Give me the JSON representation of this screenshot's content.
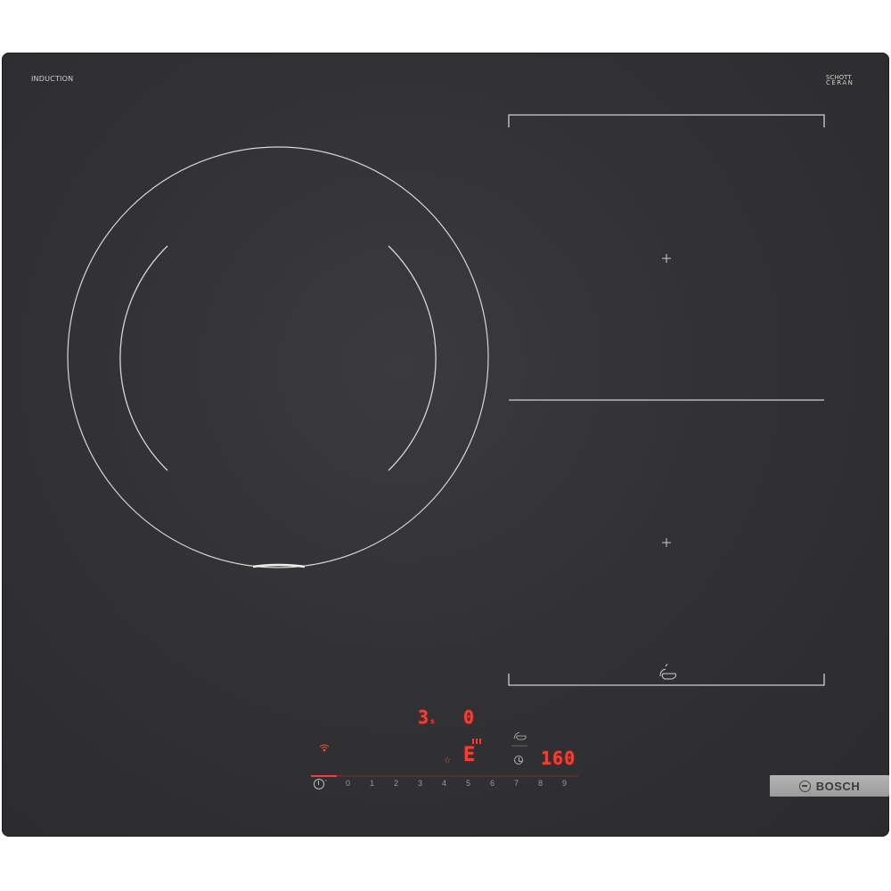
{
  "branding": {
    "induction_label": "INDUCTION",
    "schott_line1": "SCHOTT",
    "schott_line2": "CERAN",
    "brand_name": "BOSCH"
  },
  "displays": {
    "timer_seconds_digit": "3",
    "timer_seconds_suffix": "s",
    "zone_level": "0",
    "error_code": "E",
    "temperature": "160"
  },
  "power_slider": {
    "levels": [
      "0",
      "1",
      "2",
      "3",
      "4",
      "5",
      "6",
      "7",
      "8",
      "9"
    ]
  },
  "icons": {
    "power": "power-icon",
    "wifi": "wifi-icon",
    "timer": "timer-icon",
    "favorite": "star-icon",
    "pan": "pan-icon",
    "sensor": "pan-sensor-icon"
  },
  "colors": {
    "glass": "#323234",
    "lines": "#d8d8d8",
    "display_red": "#ff3b30",
    "badge": "#a8a8a8"
  }
}
